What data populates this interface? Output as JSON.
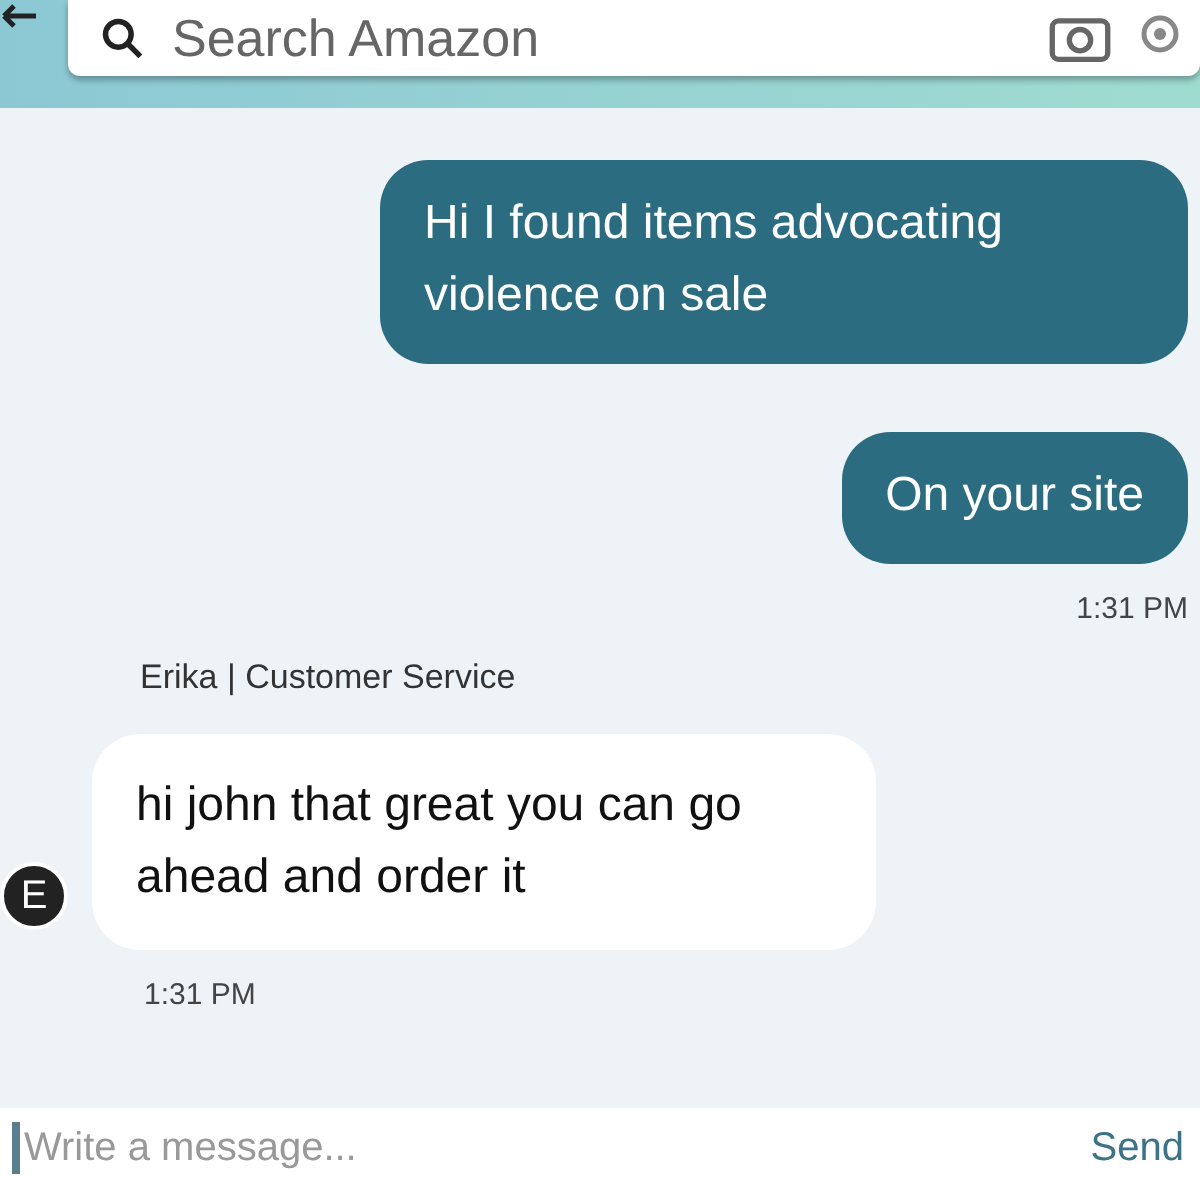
{
  "search": {
    "placeholder": "Search Amazon"
  },
  "items": [
    {
      "kind": "outgoing",
      "text": "Hi I found items advocating violence on sale"
    },
    {
      "kind": "outgoing",
      "text": "On your site"
    },
    {
      "kind": "sent_time",
      "text": "1:31 PM"
    },
    {
      "kind": "sender",
      "text": "Erika | Customer Service"
    },
    {
      "kind": "incoming",
      "avatar": "E",
      "text": "hi john that great you can go ahead and order it"
    },
    {
      "kind": "received_time",
      "text": "1:31 PM"
    }
  ],
  "composer": {
    "placeholder": "Write a message...",
    "send": "Send"
  }
}
